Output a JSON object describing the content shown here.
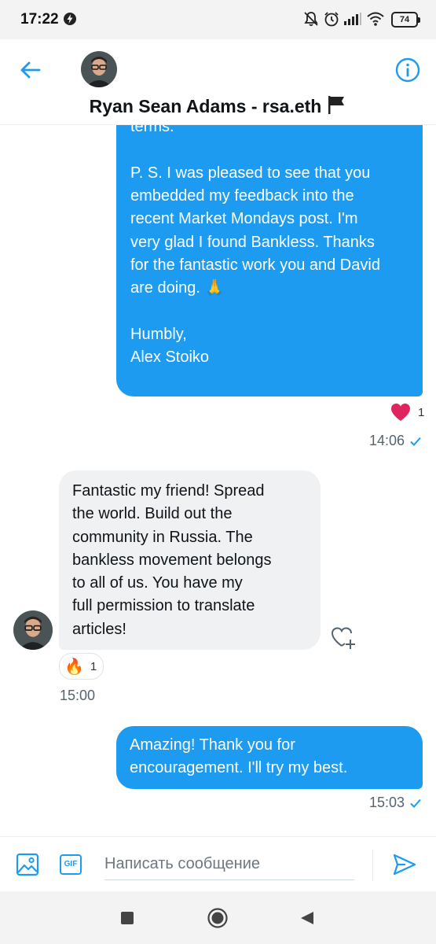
{
  "status_bar": {
    "time": "17:22",
    "battery": "74",
    "icons": [
      "data-saver-icon",
      "mute-icon",
      "alarm-icon",
      "signal-icon",
      "wifi-icon",
      "battery-icon"
    ]
  },
  "header": {
    "contact_name": "Ryan Sean Adams - rsa.eth",
    "back_icon": "arrow-left-icon",
    "info_icon": "info-icon"
  },
  "conversation": {
    "messages": [
      {
        "direction": "outgoing",
        "paragraphs": [
          "negotiating with them about the\nterms.",
          "P. S. I was pleased to see that you\nembedded my feedback into the\nrecent Market Mondays post. I'm\nvery glad I found Bankless. Thanks\nfor the fantastic work you and David\nare doing. 🙏",
          "Humbly,\nAlex Stoiko"
        ],
        "reaction": {
          "emoji": "heart",
          "count": "1"
        },
        "time": "14:06"
      },
      {
        "direction": "incoming",
        "text": "Fantastic my friend! Spread\nthe world. Build out the\ncommunity in Russia. The\nbankless movement belongs\nto all of us. You have my\nfull permission to translate\narticles!",
        "reaction": {
          "emoji": "🔥",
          "count": "1"
        },
        "time": "15:00"
      },
      {
        "direction": "outgoing",
        "text": "Amazing! Thank you for\nencouragement. I'll try my best.",
        "time": "15:03"
      }
    ]
  },
  "composer": {
    "placeholder": "Написать сообщение",
    "gif_label": "GIF"
  },
  "colors": {
    "accent": "#1d9bf0",
    "incoming_bubble": "#eff1f3",
    "heart": "#e0245e"
  }
}
